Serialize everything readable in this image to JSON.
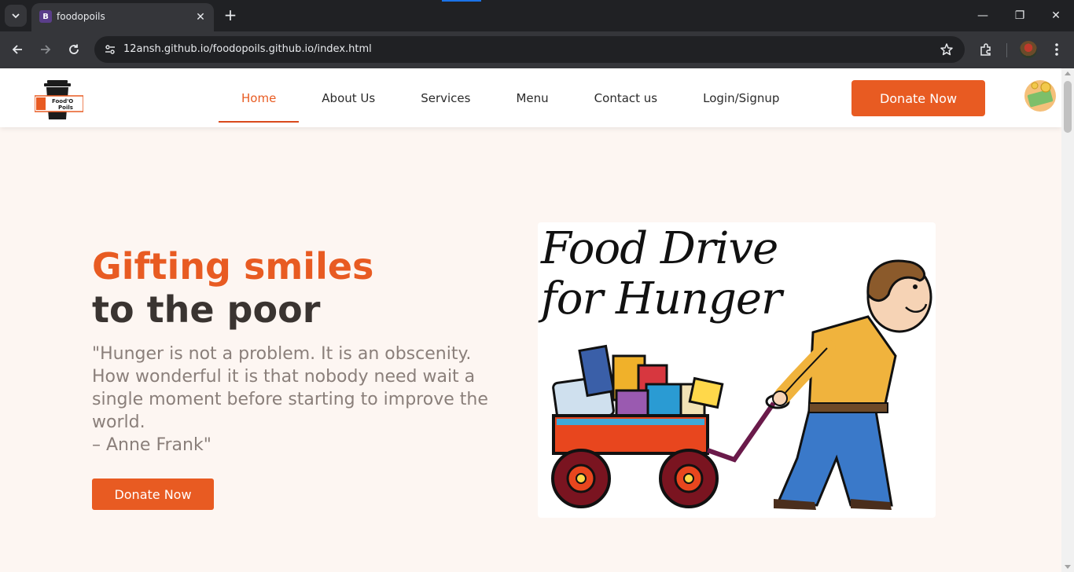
{
  "browser": {
    "tab_title": "foodopoils",
    "tab_favicon_letter": "B",
    "url": "12ansh.github.io/foodopoils.github.io/index.html"
  },
  "logo": {
    "line1": "Food'O",
    "line2": "Poils"
  },
  "nav": {
    "items": [
      {
        "label": "Home",
        "active": true
      },
      {
        "label": "About Us"
      },
      {
        "label": "Services"
      },
      {
        "label": "Menu"
      },
      {
        "label": "Contact us"
      },
      {
        "label": "Login/Signup"
      }
    ],
    "donate_label": "Donate Now"
  },
  "hero": {
    "title_line1": "Gifting smiles",
    "title_line2": "to the poor",
    "quote": "\"Hunger is not a problem. It is an obscenity. How wonderful it is that nobody need wait a single moment before starting to improve the world.\n– Anne Frank\"",
    "donate_label": "Donate Now",
    "image_text": "Food Drive\nfor Hunger"
  },
  "colors": {
    "accent": "#e85b22",
    "page_bg": "#fdf6f2",
    "dark_text": "#3a3431",
    "quote_text": "#8a7f7a"
  }
}
